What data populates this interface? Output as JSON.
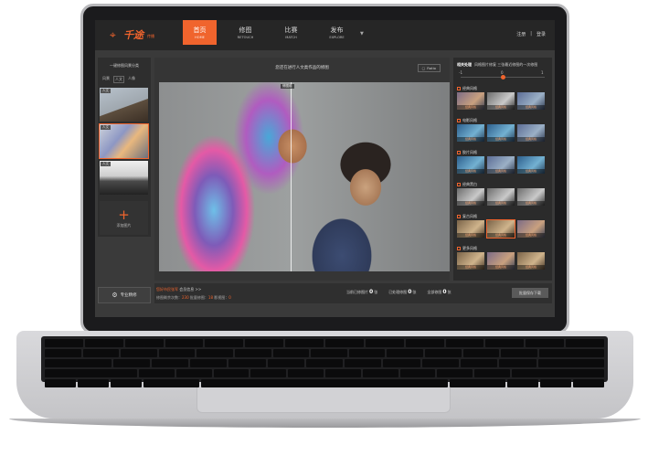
{
  "header": {
    "logo_text": "千途",
    "logo_sub": "传播",
    "nav": [
      {
        "cn": "首页",
        "en": "HOME",
        "active": true
      },
      {
        "cn": "修图",
        "en": "RETOUCH",
        "active": false
      },
      {
        "cn": "比赛",
        "en": "MATCH",
        "active": false
      },
      {
        "cn": "发布",
        "en": "EXPLORE",
        "active": false
      }
    ],
    "login": "注册",
    "register": "登录"
  },
  "sidebar": {
    "title": "一键修图风景分类",
    "filters": [
      "风景",
      "人文",
      "人像"
    ],
    "thumbs": [
      {
        "tag": "人文"
      },
      {
        "tag": "人文"
      },
      {
        "tag": "人文"
      }
    ],
    "add_label": "添加图片",
    "pro_label": "专业精修"
  },
  "center": {
    "title": "您还在进行人文类作品的修图",
    "fs_label": "Ratio",
    "split_label": "修图前"
  },
  "right": {
    "top_title": "相关处理",
    "top_desc": "风格图片修复  三张最近修图的一次修图",
    "slider": {
      "min": "-1",
      "mid": "0",
      "max": "1"
    },
    "categories": [
      {
        "name": "经典风格",
        "filter_label": "经典风格"
      },
      {
        "name": "电影风格",
        "filter_label": "经典风格"
      },
      {
        "name": "胶片风格",
        "filter_label": "经典风格"
      },
      {
        "name": "经典黑白",
        "filter_label": "经典风格"
      },
      {
        "name": "复古风格",
        "filter_label": "经典风格"
      },
      {
        "name": "更多风格",
        "filter_label": "经典风格"
      }
    ]
  },
  "bottom": {
    "line1_orange": "您好市民张军",
    "line1": "会员信息 >>",
    "line2_a": "修图剩余次数：",
    "line2_a_val": "230",
    "line2_b": "  批量修图：",
    "line2_b_val": "18",
    "line2_c": "  影视图：",
    "line2_c_val": "0",
    "stats": [
      {
        "label": "当前已修图片",
        "value": "0",
        "unit": "张"
      },
      {
        "label": "已处理修图",
        "value": "0",
        "unit": "张"
      },
      {
        "label": "全部修图",
        "value": "0",
        "unit": "张"
      }
    ],
    "button": "批量保存下载"
  }
}
